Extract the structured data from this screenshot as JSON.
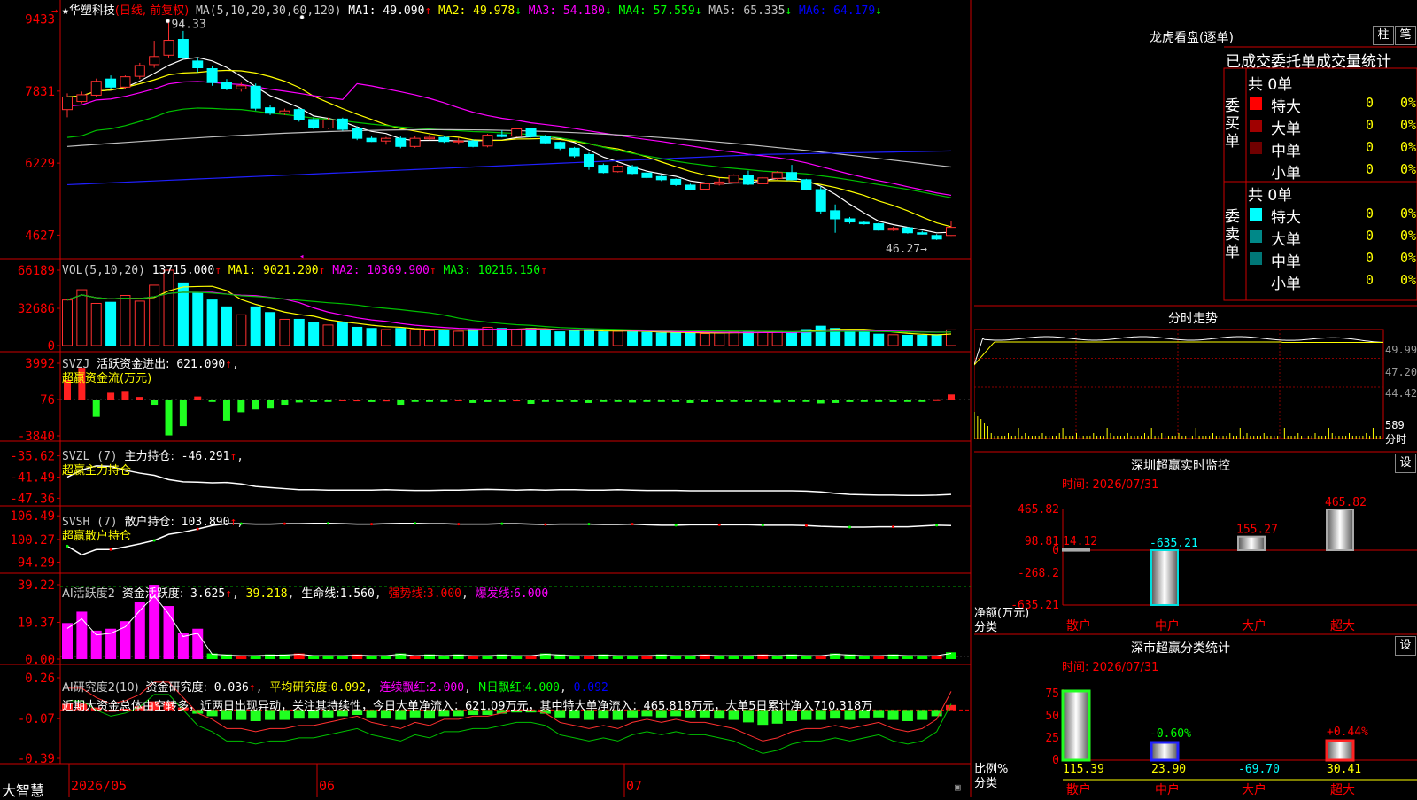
{
  "app_name": "大智慧",
  "stock": {
    "star": "★",
    "name": "华塑科技",
    "period": "(日线, 前复权)",
    "ma_title": "MA(5,10,20,30,60,120)",
    "ma": [
      {
        "label": "MA1:",
        "value": "49.090",
        "arrow": "↑",
        "color": "#ffffff"
      },
      {
        "label": "MA2:",
        "value": "49.978",
        "arrow": "↓",
        "color": "#ffff00"
      },
      {
        "label": "MA3:",
        "value": "54.180",
        "arrow": "↓",
        "color": "#ff00ff"
      },
      {
        "label": "MA4:",
        "value": "57.559",
        "arrow": "↓",
        "color": "#00ff00"
      },
      {
        "label": "MA5:",
        "value": "65.335",
        "arrow": "↓",
        "color": "#c0c0c0"
      },
      {
        "label": "MA6:",
        "value": "64.179",
        "arrow": "↓",
        "color": "#0000ff"
      }
    ],
    "high_label": "94.33",
    "low_label": "46.27"
  },
  "axes": {
    "price": [
      "9433",
      "7831",
      "6229",
      "4627"
    ],
    "vol": [
      "66189",
      "32686",
      "0"
    ],
    "svzj": [
      "3992",
      "76",
      "-3840"
    ],
    "svzl": [
      "-35.62",
      "-41.49",
      "-47.36"
    ],
    "svsh": [
      "106.49",
      "100.27",
      "94.29"
    ],
    "ai1": [
      "39.22",
      "19.37",
      "0.00"
    ],
    "ai2": [
      "0.26",
      "-0.07",
      "-0.39"
    ],
    "dates": [
      "2026/05",
      "06",
      "07"
    ]
  },
  "vol_header": {
    "title": "VOL(5,10,20)",
    "value": "13715.000",
    "arrow": "↑",
    "ma": [
      {
        "label": "MA1:",
        "value": "9021.200",
        "arrow": "↑",
        "color": "#ffff00"
      },
      {
        "label": "MA2:",
        "value": "10369.900",
        "arrow": "↑",
        "color": "#ff00ff"
      },
      {
        "label": "MA3:",
        "value": "10216.150",
        "arrow": "↑",
        "color": "#00ff00"
      }
    ]
  },
  "svzj_header": {
    "title": "SVZJ",
    "item": "活跃资金进出:",
    "value": "621.090",
    "arrow": "↑",
    "sub": "超赢资金流(万元)"
  },
  "svzl_header": {
    "title": "SVZL (7)",
    "item": "主力持仓:",
    "value": "-46.291",
    "arrow": "↑",
    "sub": "超赢主力持仓"
  },
  "svsh_header": {
    "title": "SVSH (7)",
    "item": "散户持仓:",
    "value": "103.890",
    "arrow": "↑",
    "sub": "超赢散户持仓"
  },
  "ai1_header": {
    "title": "AI活跃度2",
    "item": "资金活跃度:",
    "value": "3.625",
    "arrow": "↑",
    "v2": "39.218",
    "life_label": "生命线:",
    "life": "1.560",
    "strong_label": "强势线:",
    "strong": "3.000",
    "burst_label": "爆发线:",
    "burst": "6.000"
  },
  "ai2_header": {
    "title": "AI研究度2(10)",
    "item": "资金研究度:",
    "value": "0.036",
    "arrow": "↑",
    "avg_label": "平均研究度:",
    "avg": "0.092",
    "cont_label": "连续飘红:",
    "cont": "2.000",
    "n_label": "N日飘红:",
    "n": "4.000",
    "last": "0.092"
  },
  "commentary": "近期大资金总体由空转多，近两日出现异动，关注其持续性，今日大单净流入：621.09万元，其中特大单净流入：465.818万元，大单5日累计净入710.318万",
  "right": {
    "dragon_title": "龙虎看盘(逐单)",
    "btn_zhu": "柱",
    "btn_bi": "笔",
    "stats_title": "已成交委托单成交量统计",
    "buy_label": "委买单",
    "sell_label": "委卖单",
    "buy_total": "共 0单",
    "sell_total": "共 0单",
    "buy_rows": [
      {
        "name": "特大",
        "count": "0",
        "pct": "0%",
        "color": "#ff0000"
      },
      {
        "name": "大单",
        "count": "0",
        "pct": "0%",
        "color": "#a00000"
      },
      {
        "name": "中单",
        "count": "0",
        "pct": "0%",
        "color": "#700000"
      },
      {
        "name": "小单",
        "count": "0",
        "pct": "0%",
        "color": ""
      }
    ],
    "sell_rows": [
      {
        "name": "特大",
        "count": "0",
        "pct": "0%",
        "color": "#00ffff"
      },
      {
        "name": "大单",
        "count": "0",
        "pct": "0%",
        "color": "#008888"
      },
      {
        "name": "中单",
        "count": "0",
        "pct": "0%",
        "color": "#007777"
      },
      {
        "name": "小单",
        "count": "0",
        "pct": "0%",
        "color": ""
      }
    ],
    "intraday_title": "分时走势",
    "intraday_axis": [
      "49.99",
      "47.20",
      "44.42",
      "589",
      "分时"
    ],
    "monitor_title": "深圳超赢实时监控",
    "monitor_settings": "设",
    "monitor_time": "时间: 2026/07/31",
    "monitor_axis": [
      "465.82",
      "98.81",
      "0",
      "-268.2",
      "-635.21"
    ],
    "monitor_ylabel": "净额(万元)",
    "monitor_xlabel": "分类",
    "class_title": "深市超赢分类统计",
    "class_settings": "设",
    "class_time": "时间: 2026/07/31",
    "class_axis": [
      "75",
      "50",
      "25",
      "0"
    ],
    "class_ylabel": "比例%",
    "class_xlabel": "分类",
    "class_pct_labels": [
      "-0.60%",
      "+0.44%"
    ],
    "class_values": [
      "115.39",
      "23.90",
      "-69.70",
      "30.41"
    ],
    "categories": [
      "散户",
      "中户",
      "大户",
      "超大"
    ]
  },
  "chart_data": [
    {
      "type": "candlestick",
      "title": "华塑科技 (日线, 前复权)",
      "y_ticks": [
        9433,
        7831,
        6229,
        4627
      ],
      "ylim": [
        4300,
        9700
      ],
      "high": 94.33,
      "low": 46.27,
      "ohlc": [
        [
          7420,
          7700,
          7250,
          7780
        ],
        [
          7600,
          7750,
          7560,
          7820
        ],
        [
          7740,
          8050,
          7700,
          8110
        ],
        [
          8100,
          7920,
          7880,
          8180
        ],
        [
          7920,
          8150,
          7880,
          8180
        ],
        [
          8160,
          8400,
          8100,
          8460
        ],
        [
          8420,
          8600,
          8350,
          8950
        ],
        [
          8630,
          8960,
          8580,
          9433
        ],
        [
          8980,
          8580,
          8550,
          9170
        ],
        [
          8500,
          8350,
          8250,
          8560
        ],
        [
          8330,
          8020,
          7950,
          8400
        ],
        [
          8030,
          7880,
          7850,
          8100
        ],
        [
          7880,
          7950,
          7820,
          8020
        ],
        [
          7940,
          7450,
          7400,
          8000
        ],
        [
          7460,
          7340,
          7300,
          7520
        ],
        [
          7340,
          7390,
          7300,
          7440
        ],
        [
          7420,
          7200,
          7150,
          7450
        ],
        [
          7200,
          7010,
          6980,
          7250
        ],
        [
          7010,
          7190,
          6990,
          7240
        ],
        [
          7210,
          6980,
          6950,
          7240
        ],
        [
          6990,
          6780,
          6740,
          7050
        ],
        [
          6780,
          6710,
          6700,
          6820
        ],
        [
          6720,
          6780,
          6640,
          6810
        ],
        [
          6780,
          6600,
          6560,
          6830
        ],
        [
          6600,
          6780,
          6570,
          6830
        ],
        [
          6770,
          6800,
          6740,
          6860
        ],
        [
          6800,
          6710,
          6680,
          6840
        ],
        [
          6700,
          6720,
          6640,
          6790
        ],
        [
          6720,
          6600,
          6580,
          6760
        ],
        [
          6610,
          6850,
          6580,
          6880
        ],
        [
          6860,
          6820,
          6800,
          6960
        ],
        [
          6830,
          6990,
          6810,
          7010
        ],
        [
          7000,
          6820,
          6800,
          7020
        ],
        [
          6820,
          6680,
          6650,
          6860
        ],
        [
          6690,
          6560,
          6520,
          6710
        ],
        [
          6560,
          6390,
          6350,
          6590
        ],
        [
          6420,
          6160,
          6080,
          6460
        ],
        [
          6180,
          6020,
          6000,
          6220
        ],
        [
          6040,
          6160,
          6020,
          6200
        ],
        [
          6150,
          6000,
          5980,
          6190
        ],
        [
          6010,
          5910,
          5880,
          6040
        ],
        [
          5930,
          5860,
          5830,
          5960
        ],
        [
          5870,
          5750,
          5720,
          5890
        ],
        [
          5740,
          5650,
          5620,
          5770
        ],
        [
          5650,
          5770,
          5640,
          5790
        ],
        [
          5760,
          5810,
          5730,
          5900
        ],
        [
          5800,
          5960,
          5780,
          5980
        ],
        [
          5960,
          5760,
          5740,
          6060
        ],
        [
          5770,
          5900,
          5760,
          5920
        ],
        [
          5890,
          6020,
          5860,
          6050
        ],
        [
          6020,
          5860,
          5850,
          6190
        ],
        [
          5860,
          5650,
          5620,
          5880
        ],
        [
          5640,
          5160,
          5100,
          5700
        ],
        [
          5170,
          4990,
          4680,
          5310
        ],
        [
          4990,
          4920,
          4880,
          5030
        ],
        [
          4910,
          4880,
          4860,
          4940
        ],
        [
          4880,
          4740,
          4720,
          4910
        ],
        [
          4740,
          4780,
          4720,
          4810
        ],
        [
          4790,
          4680,
          4660,
          4810
        ],
        [
          4680,
          4650,
          4640,
          4720
        ],
        [
          4620,
          4540,
          4520,
          4650
        ],
        [
          4620,
          4800,
          4610,
          4940
        ]
      ]
    },
    {
      "type": "bar",
      "title": "VOL(5,10,20)",
      "y_ticks": [
        66189,
        32686,
        0
      ],
      "ylim": [
        0,
        66189
      ],
      "values": [
        40000,
        49000,
        37000,
        38000,
        44000,
        39000,
        53000,
        66189,
        55000,
        46000,
        40000,
        34000,
        27000,
        34000,
        29000,
        23000,
        23000,
        20000,
        18000,
        20000,
        16000,
        15000,
        14000,
        15000,
        14000,
        13000,
        13500,
        12500,
        14000,
        16000,
        15000,
        14000,
        15000,
        13000,
        12000,
        13000,
        14000,
        12000,
        12500,
        12000,
        11500,
        11000,
        11500,
        11000,
        10500,
        11000,
        12000,
        12000,
        11500,
        12500,
        12000,
        14000,
        17000,
        15000,
        13000,
        12000,
        10000,
        9500,
        9000,
        9000,
        9500,
        13715
      ]
    },
    {
      "type": "bar",
      "title": "SVZJ 活跃资金进出",
      "y_ticks": [
        3992,
        76,
        -3840
      ],
      "ylim": [
        -3840,
        3992
      ],
      "values": [
        2200,
        3500,
        -1800,
        800,
        1000,
        350,
        -500,
        -3800,
        -2800,
        400,
        -80,
        -2200,
        -1300,
        -1000,
        -900,
        -500,
        -250,
        -200,
        -180,
        80,
        70,
        -200,
        60,
        -500,
        -150,
        -100,
        -150,
        80,
        -300,
        -200,
        -100,
        70,
        -400,
        -150,
        -100,
        -200,
        -300,
        -100,
        -100,
        -250,
        -150,
        -100,
        -150,
        -300,
        -200,
        -200,
        -100,
        -150,
        -100,
        -250,
        -150,
        -100,
        -350,
        -300,
        -200,
        -150,
        -100,
        -200,
        -150,
        -100,
        100,
        621
      ]
    },
    {
      "type": "line",
      "title": "SVZL 主力持仓",
      "y_ticks": [
        -35.62,
        -41.49,
        -47.36
      ],
      "ylim": [
        -48,
        -34
      ],
      "values": [
        -41.5,
        -39.5,
        -38.4,
        -38.5,
        -39.6,
        -40.4,
        -41.0,
        -42.2,
        -42.8,
        -42.9,
        -43.1,
        -43.0,
        -43.4,
        -44.1,
        -44.4,
        -44.7,
        -45.0,
        -45.0,
        -45.1,
        -45.1,
        -45.1,
        -45.1,
        -45.0,
        -45.1,
        -45.2,
        -45.2,
        -45.1,
        -45.1,
        -45.0,
        -44.9,
        -45.0,
        -45.1,
        -45.0,
        -45.1,
        -45.0,
        -45.0,
        -45.1,
        -45.1,
        -45.0,
        -45.1,
        -45.2,
        -45.2,
        -45.2,
        -45.3,
        -45.3,
        -45.3,
        -45.3,
        -45.3,
        -45.3,
        -45.3,
        -45.3,
        -45.4,
        -45.6,
        -46.0,
        -46.3,
        -46.4,
        -46.5,
        -46.5,
        -46.6,
        -46.6,
        -46.5,
        -46.3
      ]
    },
    {
      "type": "line",
      "title": "SVSH 散户持仓",
      "y_ticks": [
        106.49,
        100.27,
        94.29
      ],
      "ylim": [
        93,
        107
      ],
      "values": [
        98.5,
        96.2,
        97.6,
        97.6,
        98.3,
        99.1,
        100.0,
        101.6,
        102.2,
        103.0,
        103.9,
        104.4,
        104.4,
        104.3,
        104.3,
        104.4,
        104.4,
        104.5,
        104.5,
        104.4,
        104.3,
        104.3,
        104.4,
        104.5,
        104.5,
        104.4,
        104.4,
        104.3,
        104.3,
        104.3,
        104.4,
        104.4,
        104.3,
        104.2,
        104.3,
        104.3,
        104.3,
        104.2,
        104.2,
        104.3,
        104.1,
        104.0,
        104.0,
        104.1,
        104.1,
        104.1,
        104.1,
        104.1,
        104.0,
        104.0,
        104.0,
        103.9,
        103.7,
        103.6,
        103.5,
        103.5,
        103.6,
        103.6,
        103.6,
        103.8,
        104.0,
        103.9
      ]
    },
    {
      "type": "bar",
      "title": "AI活跃度2",
      "y_ticks": [
        39.22,
        19.37,
        0.0
      ],
      "ylim": [
        0,
        39.22
      ],
      "values": [
        19,
        25,
        15,
        16,
        20,
        30,
        39.2,
        28,
        14,
        16,
        3,
        2.5,
        2,
        2,
        2.5,
        2.5,
        3,
        2,
        2,
        2,
        2.5,
        2,
        2,
        3,
        2,
        2.5,
        2,
        2.5,
        2,
        2,
        2.5,
        2,
        2,
        3,
        2.5,
        2,
        2,
        2.5,
        2,
        2,
        2,
        2.5,
        2,
        2,
        2.5,
        2,
        2,
        2,
        2.5,
        2,
        2.5,
        2,
        2,
        3,
        2.5,
        2,
        2,
        2.5,
        2,
        2,
        2,
        3.6
      ]
    },
    {
      "type": "bar",
      "title": "AI研究度2(10)",
      "y_ticks": [
        0.26,
        -0.07,
        -0.39
      ],
      "ylim": [
        -0.39,
        0.26
      ],
      "values": [
        0.05,
        0.05,
        0.02,
        0.0,
        0.01,
        0.03,
        0.07,
        0.07,
        0.02,
        -0.03,
        -0.05,
        -0.08,
        -0.08,
        -0.09,
        -0.08,
        -0.08,
        -0.07,
        -0.07,
        -0.06,
        -0.05,
        -0.04,
        -0.06,
        -0.07,
        -0.08,
        -0.06,
        -0.07,
        -0.05,
        -0.05,
        -0.04,
        -0.04,
        -0.03,
        -0.02,
        -0.02,
        -0.03,
        -0.06,
        -0.07,
        -0.08,
        -0.07,
        -0.08,
        -0.06,
        -0.05,
        -0.06,
        -0.05,
        -0.06,
        -0.06,
        -0.07,
        -0.08,
        -0.1,
        -0.12,
        -0.11,
        -0.09,
        -0.08,
        -0.08,
        -0.07,
        -0.08,
        -0.07,
        -0.06,
        -0.08,
        -0.09,
        -0.08,
        -0.05,
        0.04
      ]
    },
    {
      "type": "bar",
      "title": "深圳超赢实时监控",
      "categories": [
        "散户",
        "中户",
        "大户",
        "超大"
      ],
      "values": [
        14.12,
        -635.21,
        155.27,
        465.82
      ],
      "y_ticks": [
        465.82,
        98.81,
        0,
        -268.2,
        -635.21
      ]
    },
    {
      "type": "bar",
      "title": "深市超赢分类统计",
      "categories": [
        "散户",
        "中户",
        "大户",
        "超大"
      ],
      "values": [
        115.39,
        23.9,
        -69.7,
        30.41
      ],
      "pct_labels": [
        "-0.60%",
        "+0.44%"
      ],
      "y_ticks": [
        75,
        50,
        25,
        0
      ]
    }
  ]
}
